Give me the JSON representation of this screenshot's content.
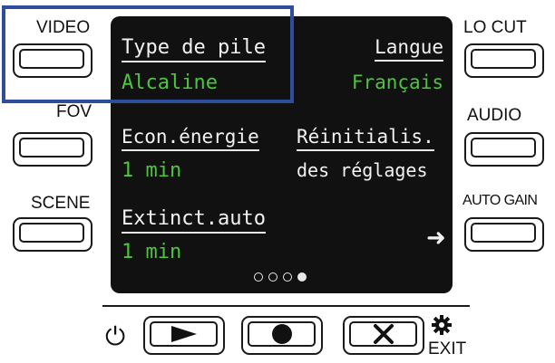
{
  "side_buttons": {
    "left": [
      "VIDEO",
      "FOV",
      "SCENE"
    ],
    "right": [
      "LO CUT",
      "AUDIO",
      "AUTO GAIN"
    ]
  },
  "screen": {
    "items": [
      {
        "label": "Type de pile",
        "value": "Alcaline"
      },
      {
        "label": "Langue",
        "value": "Français"
      },
      {
        "label": "Econ.énergie",
        "value": "1 min"
      },
      {
        "label": "Réinitialis.",
        "value": "des réglages"
      },
      {
        "label": "Extinct.auto",
        "value": "1 min"
      }
    ],
    "next_icon": "arrow-right-icon",
    "page_indicator": {
      "total": 4,
      "current": 4
    }
  },
  "controls": {
    "power_icon": "power-icon",
    "play_icon": "play-icon",
    "record_icon": "record-icon",
    "stop_icon": "x-icon",
    "gear_icon": "gear-icon",
    "exit_label": "EXIT"
  },
  "colors": {
    "screen_bg": "#111111",
    "value_text": "#4cc63f",
    "highlight_frame": "#2e4e9c"
  }
}
